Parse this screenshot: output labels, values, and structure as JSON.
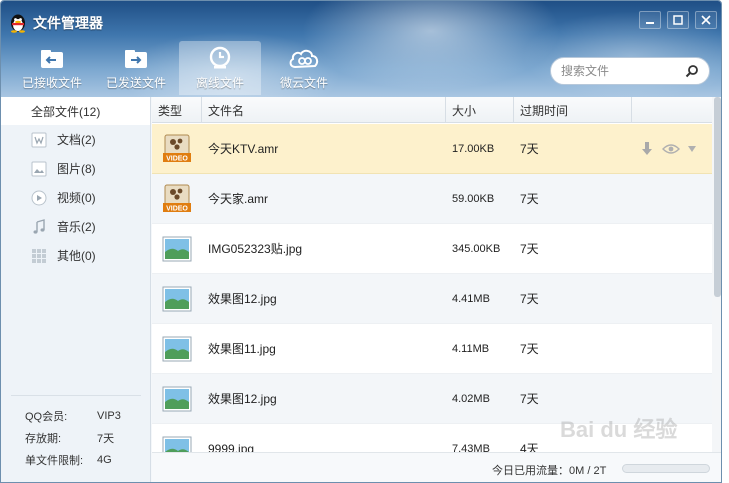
{
  "app": {
    "title": "文件管理器",
    "brand_color": "#2f6aa6"
  },
  "tabs": [
    {
      "label": "已接收文件",
      "icon": "inbox-arrow-icon",
      "active": false
    },
    {
      "label": "已发送文件",
      "icon": "outbox-arrow-icon",
      "active": false
    },
    {
      "label": "离线文件",
      "icon": "clock-upload-icon",
      "active": true
    },
    {
      "label": "微云文件",
      "icon": "cloud-icon",
      "active": false
    }
  ],
  "search": {
    "placeholder": "搜索文件"
  },
  "sidebar": {
    "items": [
      {
        "label": "全部文件(12)",
        "icon": null
      },
      {
        "label": "文档(2)",
        "icon": "document-icon"
      },
      {
        "label": "图片(8)",
        "icon": "image-icon"
      },
      {
        "label": "视频(0)",
        "icon": "video-play-icon"
      },
      {
        "label": "音乐(2)",
        "icon": "music-note-icon"
      },
      {
        "label": "其他(0)",
        "icon": "grid-icon"
      }
    ],
    "info": [
      {
        "key": "QQ会员:",
        "value": "VIP3"
      },
      {
        "key": "存放期:",
        "value": "7天"
      },
      {
        "key": "单文件限制:",
        "value": "4G"
      }
    ]
  },
  "columns": {
    "type": "类型",
    "name": "文件名",
    "size": "大小",
    "expire": "过期时间"
  },
  "files": [
    {
      "icon": "video-file-icon",
      "name": "今天KTV.amr",
      "size": "17.00KB",
      "expire": "7天",
      "selected": true
    },
    {
      "icon": "video-file-icon",
      "name": "今天家.amr",
      "size": "59.00KB",
      "expire": "7天",
      "selected": false
    },
    {
      "icon": "image-file-icon",
      "name": "IMG052323贴.jpg",
      "size": "345.00KB",
      "expire": "7天",
      "selected": false
    },
    {
      "icon": "image-file-icon",
      "name": "效果图12.jpg",
      "size": "4.41MB",
      "expire": "7天",
      "selected": false
    },
    {
      "icon": "image-file-icon",
      "name": "效果图11.jpg",
      "size": "4.11MB",
      "expire": "7天",
      "selected": false
    },
    {
      "icon": "image-file-icon",
      "name": "效果图12.jpg",
      "size": "4.02MB",
      "expire": "7天",
      "selected": false
    },
    {
      "icon": "image-file-icon",
      "name": "9999.jpg",
      "size": "7.43MB",
      "expire": "4天",
      "selected": false
    }
  ],
  "footer": {
    "traffic_label": "今日已用流量：0M / 2T"
  }
}
